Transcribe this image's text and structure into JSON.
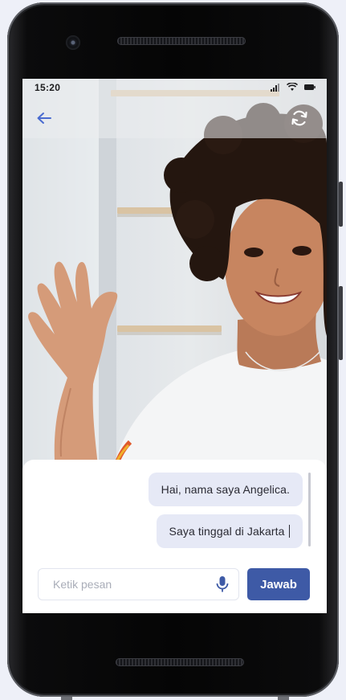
{
  "status_bar": {
    "time": "15:20",
    "icons": [
      "signal-icon",
      "wifi-icon",
      "battery-icon"
    ]
  },
  "top_bar": {
    "back_icon": "arrow-left-icon",
    "switch_icon": "camera-switch-icon"
  },
  "chat": {
    "messages": [
      {
        "text": "Hai, nama saya Angelica."
      },
      {
        "text": "Saya tinggal di Jakarta"
      }
    ]
  },
  "composer": {
    "placeholder": "Ketik pesan",
    "value": "",
    "mic_icon": "microphone-icon",
    "send_label": "Jawab"
  },
  "colors": {
    "accent": "#3e5aa6",
    "bubble": "#e6e9f6",
    "back_arrow": "#4a6bd0"
  }
}
